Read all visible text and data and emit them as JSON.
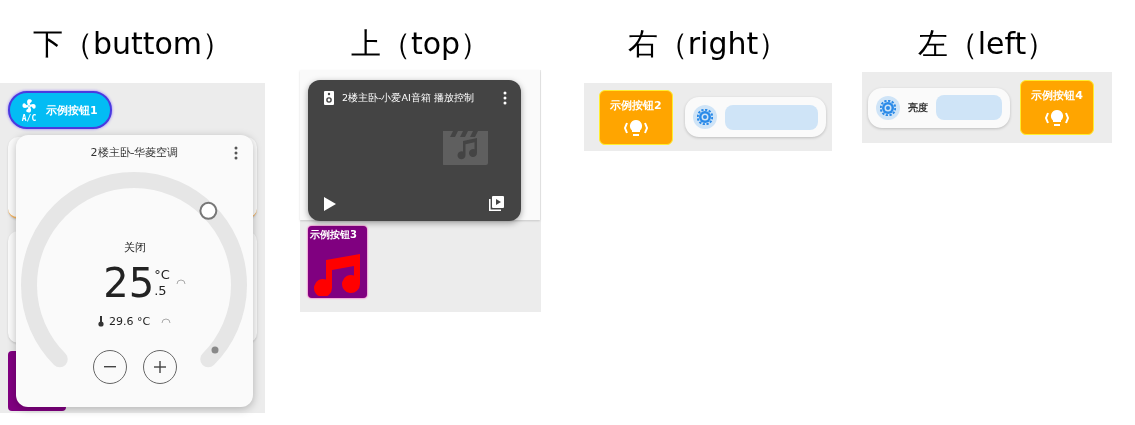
{
  "sections": [
    {
      "heading": "下（buttom）",
      "kind": "climate",
      "button": {
        "label": "示例按钮1",
        "badge": "A/C"
      },
      "popup": {
        "title": "2楼主卧-华菱空调",
        "state": "关闭",
        "target_whole": "25",
        "target_decimal": ".5",
        "unit": "°C",
        "current": "29.6 °C"
      }
    },
    {
      "heading": "上（top）",
      "kind": "media",
      "popup": {
        "title": "2楼主卧-小爱AI音箱 播放控制"
      },
      "tile": {
        "label": "示例按钮3"
      }
    },
    {
      "heading": "右（right）",
      "kind": "light-right",
      "button": {
        "label": "示例按钮2"
      }
    },
    {
      "heading": "左（left）",
      "kind": "light-left",
      "button": {
        "label": "示例按钮4"
      },
      "slider": {
        "label": "亮度"
      }
    }
  ]
}
